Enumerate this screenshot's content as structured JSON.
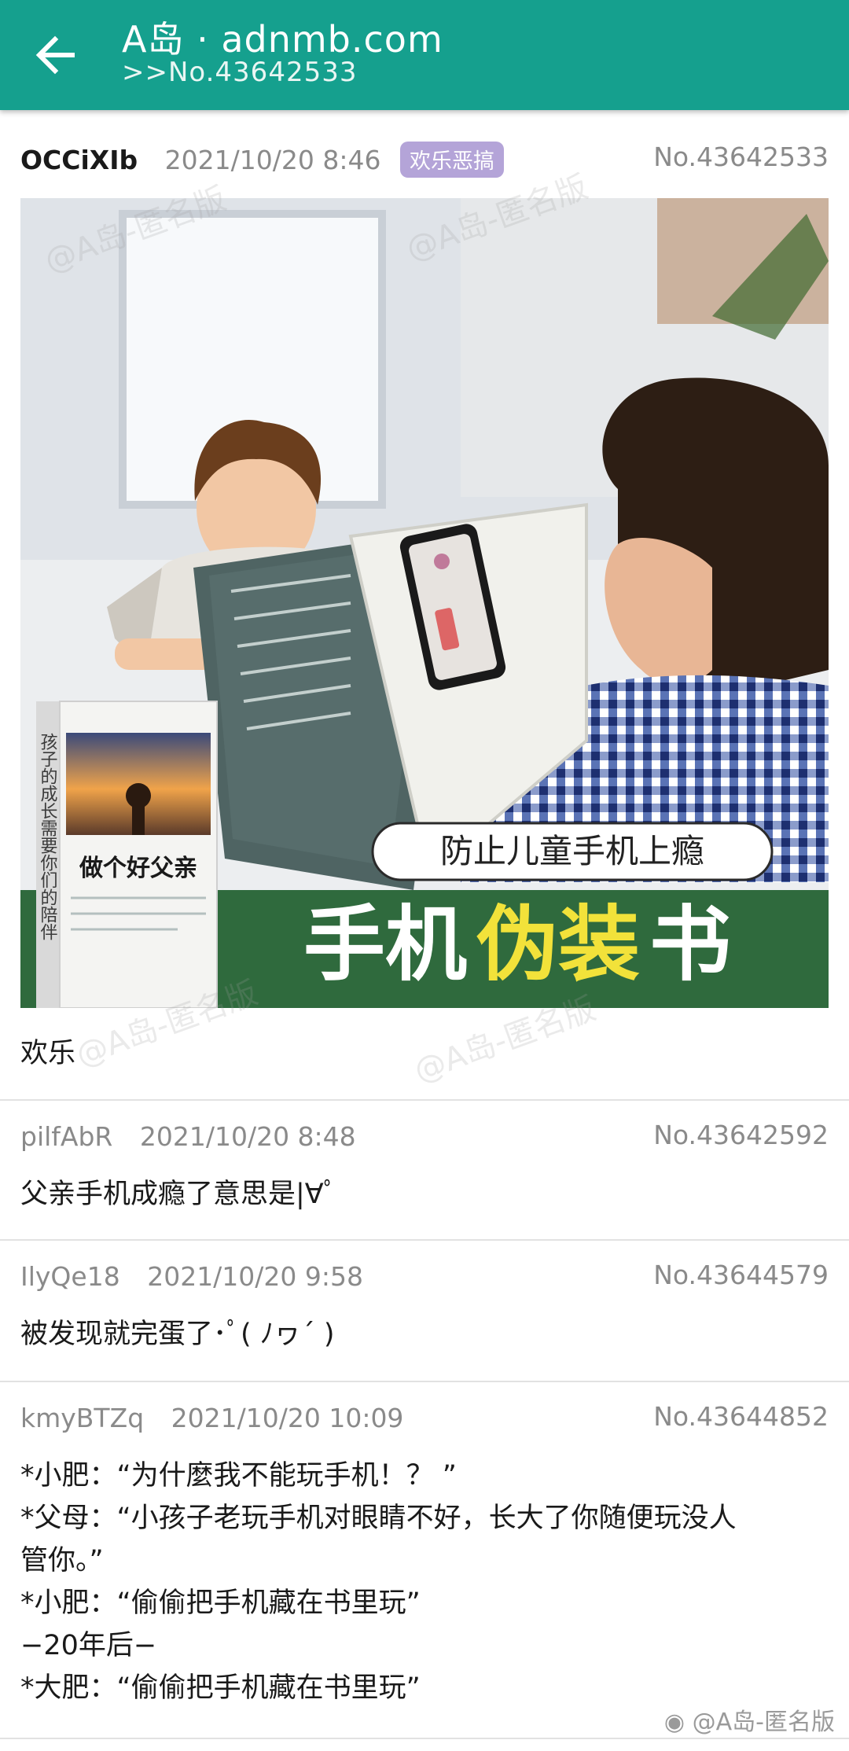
{
  "appbar": {
    "title": "A岛 · adnmb.com",
    "subtitle": ">>No.43642533",
    "color": "#15a08e"
  },
  "thread": {
    "uid": "OCCiXIb",
    "time": "2021/10/20 8:46",
    "tag": "欢乐恶搞",
    "no": "No.43642533",
    "content": "欢乐",
    "image": {
      "banner_pill": "防止儿童手机上瘾",
      "banner_main_a": "手机",
      "banner_main_b": "伪装",
      "banner_main_c": "书",
      "book_title": "做个好父亲",
      "book_spine": "孩子的成长需要你们的陪伴"
    }
  },
  "replies": [
    {
      "uid": "pilfAbR",
      "time": "2021/10/20 8:48",
      "no": "No.43642592",
      "lines": [
        "父亲手机成瘾了意思是|∀ﾟ"
      ]
    },
    {
      "uid": "IlyQe18",
      "time": "2021/10/20 9:58",
      "no": "No.43644579",
      "lines": [
        "被发现就完蛋了･ﾟ( ﾉヮ´ )"
      ]
    },
    {
      "uid": "kmyBTZq",
      "time": "2021/10/20 10:09",
      "no": "No.43644852",
      "lines": [
        "*小肥：“为什麼我不能玩手机！？ ”",
        "*父母：“小孩子老玩手机对眼睛不好，长大了你随便玩没人",
        "管你。”",
        "*小肥：“偷偷把手机藏在书里玩”",
        "−20年后−",
        "*大肥：“偷偷把手机藏在书里玩”"
      ]
    }
  ],
  "watermarks": {
    "site": "@A岛-匿名版",
    "footer": "@A岛-匿名版"
  }
}
